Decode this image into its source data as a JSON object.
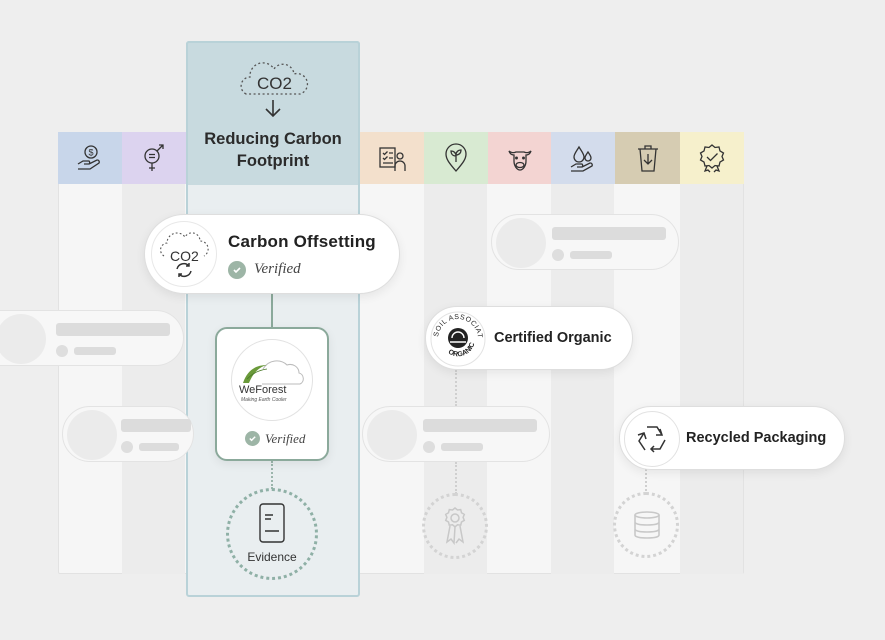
{
  "focus": {
    "co2_label": "CO2",
    "title_line1": "Reducing Carbon",
    "title_line2": "Footprint"
  },
  "header_icons": [
    {
      "name": "money-hand-icon",
      "color": "#c8d6ea"
    },
    {
      "name": "gender-equality-icon",
      "color": "#dcd3ef"
    },
    {
      "name": "checklist-person-icon",
      "color": "#f3e0cc"
    },
    {
      "name": "plant-pin-icon",
      "color": "#d8ead2"
    },
    {
      "name": "cow-icon",
      "color": "#f3d4d2"
    },
    {
      "name": "water-hand-icon",
      "color": "#d3dcec"
    },
    {
      "name": "recycle-bin-icon",
      "color": "#d6ccb2"
    },
    {
      "name": "badge-check-icon",
      "color": "#f6f0cc"
    }
  ],
  "carbon_card": {
    "icon_label": "CO2",
    "title": "Carbon Offsetting",
    "status": "Verified"
  },
  "weforest_card": {
    "logo_name": "WeForest",
    "logo_tagline": "Making Earth Cooler",
    "status": "Verified"
  },
  "evidence": {
    "label": "Evidence"
  },
  "organic_card": {
    "seal_top": "SOIL ASSOCIATION",
    "seal_bottom": "ORGANIC",
    "title": "Certified Organic"
  },
  "recycled_card": {
    "title": "Recycled Packaging"
  },
  "colors": {
    "accent": "#9db5a6",
    "focus_head": "#c8dadf",
    "focus_border": "#b9d2d8"
  }
}
